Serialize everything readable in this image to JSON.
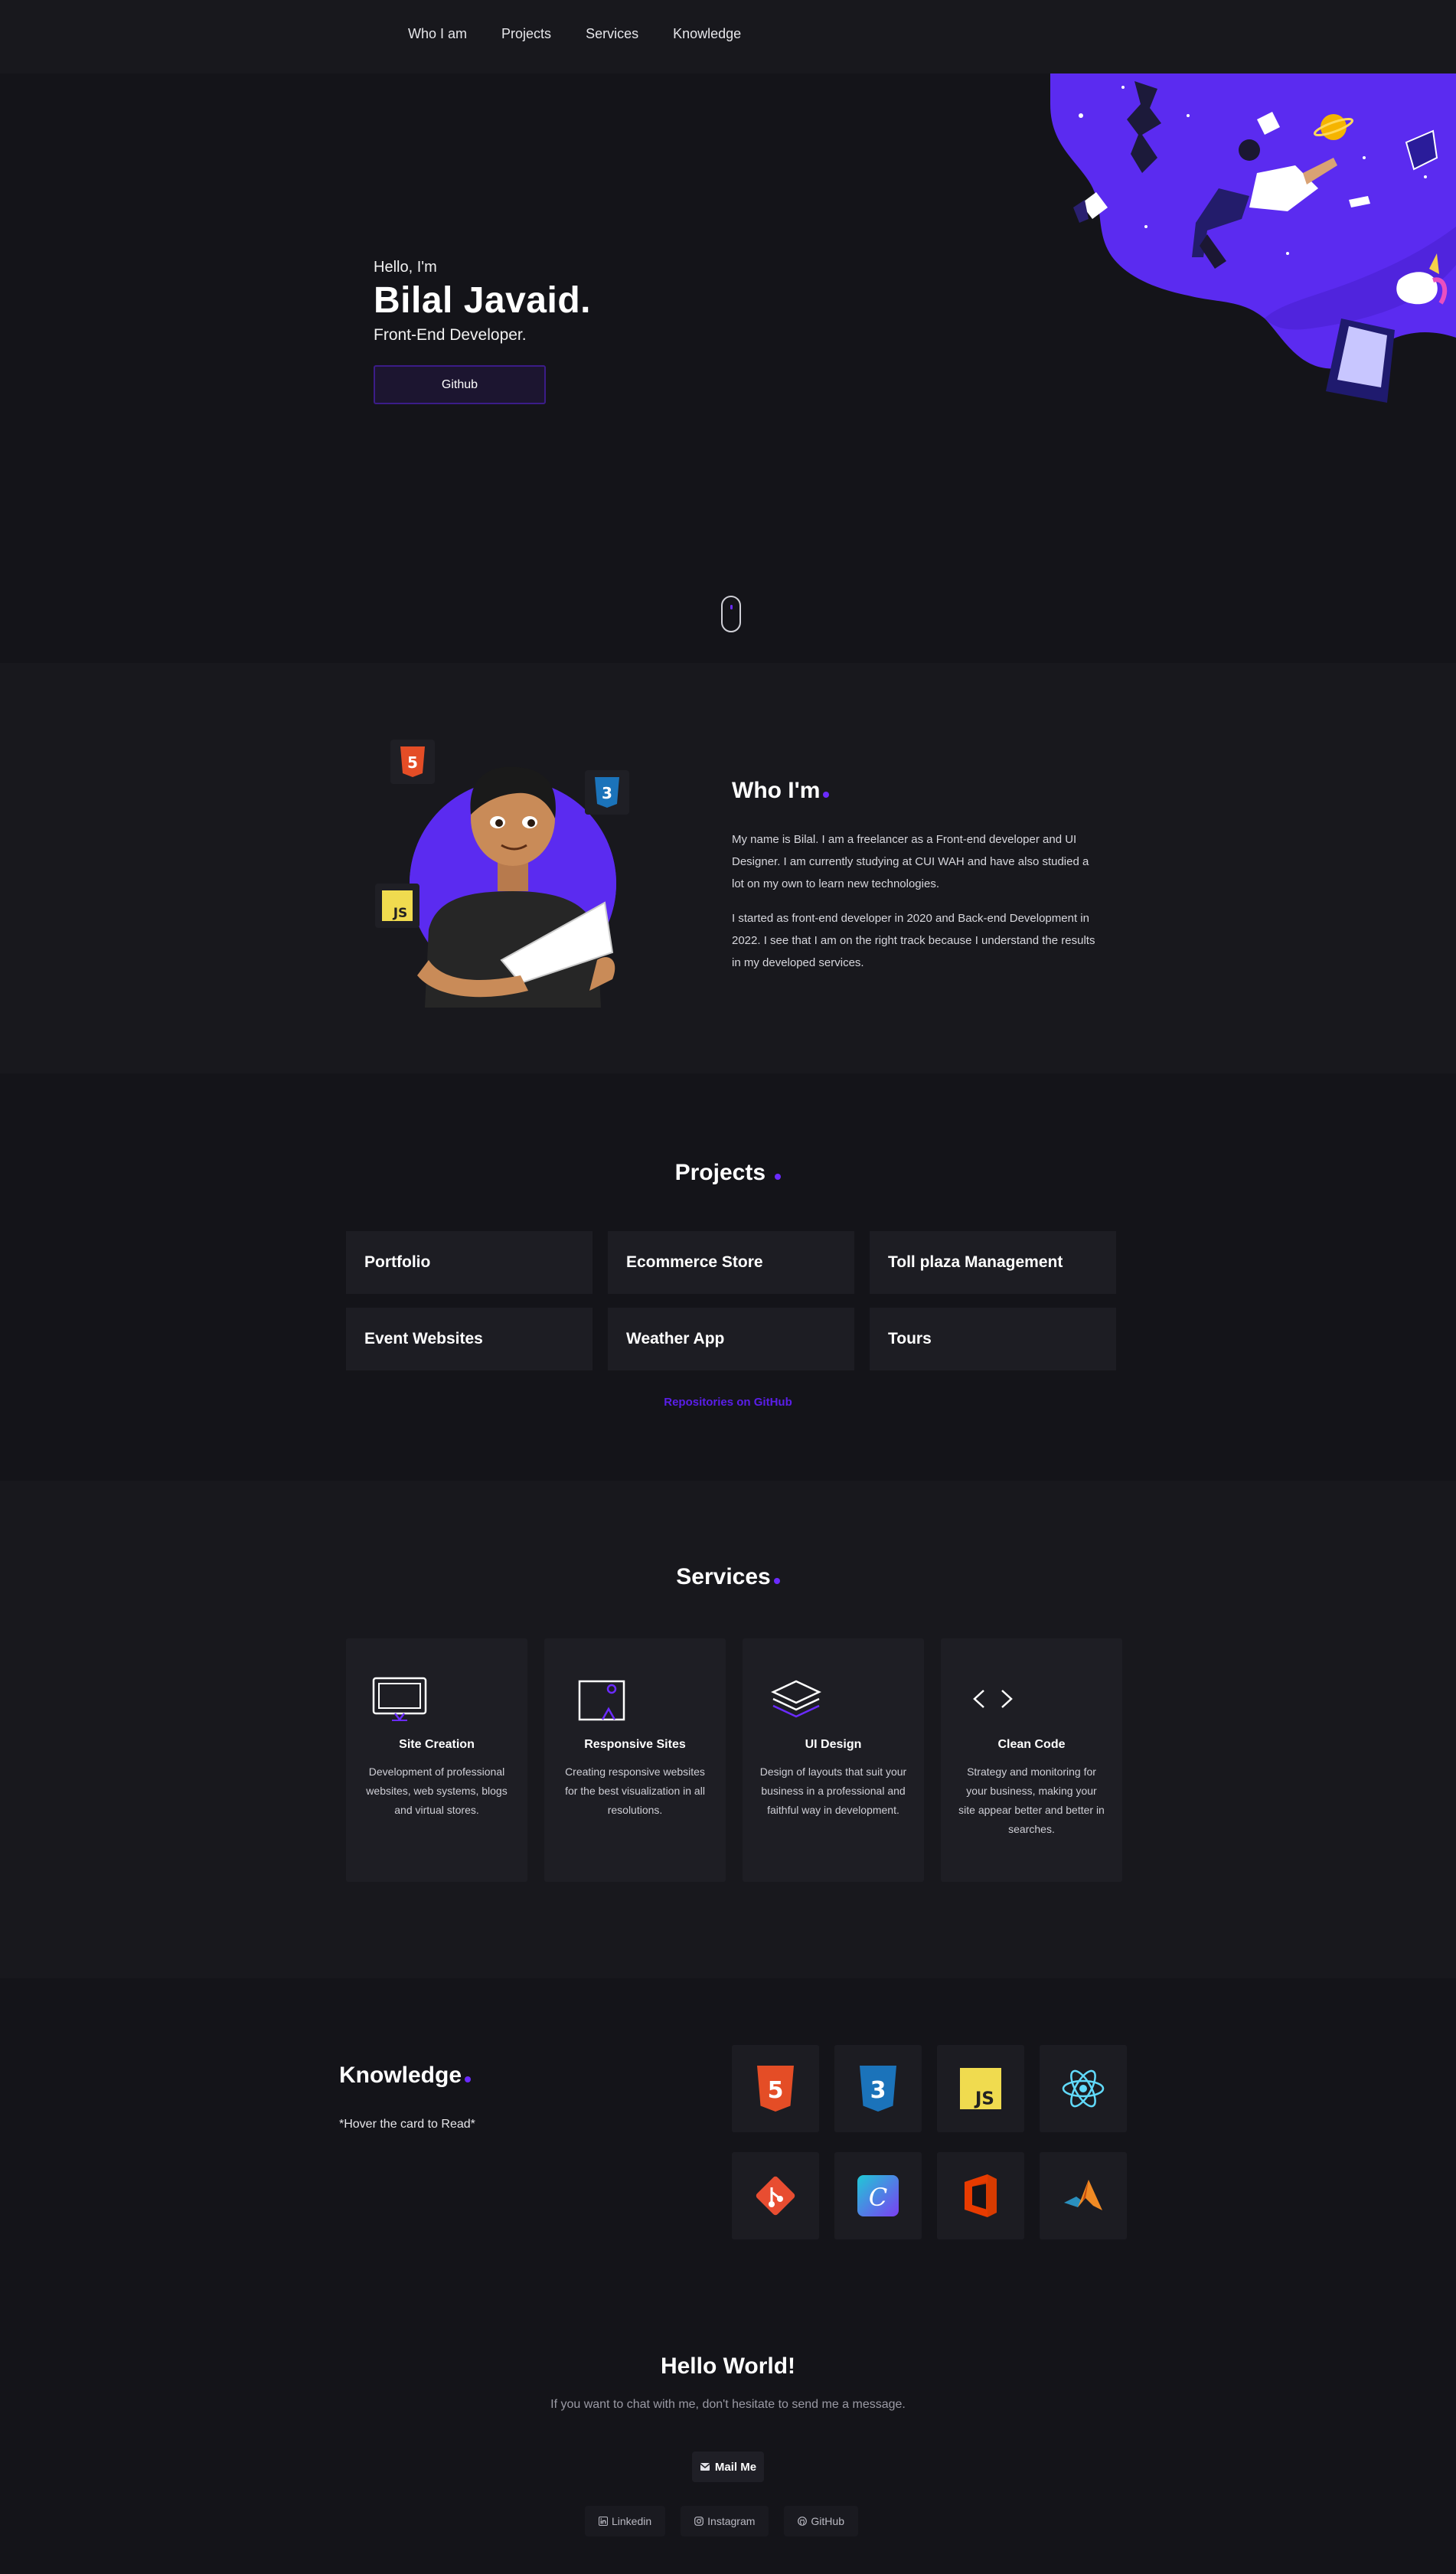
{
  "nav": {
    "items": [
      {
        "label": "Who I am"
      },
      {
        "label": "Projects"
      },
      {
        "label": "Services"
      },
      {
        "label": "Knowledge"
      }
    ]
  },
  "hero": {
    "greeting": "Hello, I'm",
    "name": "Bilal Javaid.",
    "role": "Front-End Developer.",
    "button_label": "Github",
    "art_colors": {
      "blob": "#5b2bf0",
      "accent": "#6b2bff"
    }
  },
  "about": {
    "title": "Who I'm",
    "paragraphs": [
      "My name is Bilal. I am a freelancer as a Front-end developer and UI Designer. I am currently studying at CUI WAH and have also studied a lot on my own to learn new technologies.",
      "I started as front-end developer in 2020 and Back-end Development in 2022. I see that I am on the right track because I understand the results in my developed services."
    ],
    "badges": [
      {
        "icon": "html5-icon",
        "text": "5"
      },
      {
        "icon": "css3-icon",
        "text": "3"
      },
      {
        "icon": "javascript-icon",
        "text": "JS"
      }
    ]
  },
  "projects": {
    "title": "Projects",
    "items": [
      {
        "label": "Portfolio"
      },
      {
        "label": "Ecommerce Store"
      },
      {
        "label": "Toll plaza Management"
      },
      {
        "label": "Event Websites"
      },
      {
        "label": "Weather App"
      },
      {
        "label": "Tours"
      }
    ],
    "repo_link": "Repositories on GitHub"
  },
  "services": {
    "title": "Services",
    "items": [
      {
        "icon": "monitor-icon",
        "title": "Site Creation",
        "desc": "Development of professional websites, web systems, blogs and virtual stores."
      },
      {
        "icon": "image-frame-icon",
        "title": "Responsive Sites",
        "desc": "Creating responsive websites for the best visualization in all resolutions."
      },
      {
        "icon": "layers-icon",
        "title": "UI Design",
        "desc": "Design of layouts that suit your business in a professional and faithful way in development."
      },
      {
        "icon": "code-icon",
        "title": "Clean Code",
        "desc": "Strategy and monitoring for your business, making your site appear better and better in searches."
      }
    ]
  },
  "knowledge": {
    "title": "Knowledge",
    "hint": "*Hover the card to Read*",
    "items": [
      {
        "icon": "html5-icon",
        "text": "5"
      },
      {
        "icon": "css3-icon",
        "text": "3"
      },
      {
        "icon": "javascript-icon",
        "text": "JS"
      },
      {
        "icon": "react-icon"
      },
      {
        "icon": "git-icon"
      },
      {
        "icon": "canva-icon",
        "text": "C"
      },
      {
        "icon": "office-icon"
      },
      {
        "icon": "matlab-icon"
      }
    ]
  },
  "contact": {
    "title": "Hello World!",
    "text": "If you want to chat with me, don't hesitate to send me a message.",
    "mail_label": "Mail Me",
    "socials": [
      {
        "icon": "linkedin-icon",
        "label": "Linkedin"
      },
      {
        "icon": "instagram-icon",
        "label": "Instagram"
      },
      {
        "icon": "github-icon",
        "label": "GitHub"
      }
    ]
  }
}
